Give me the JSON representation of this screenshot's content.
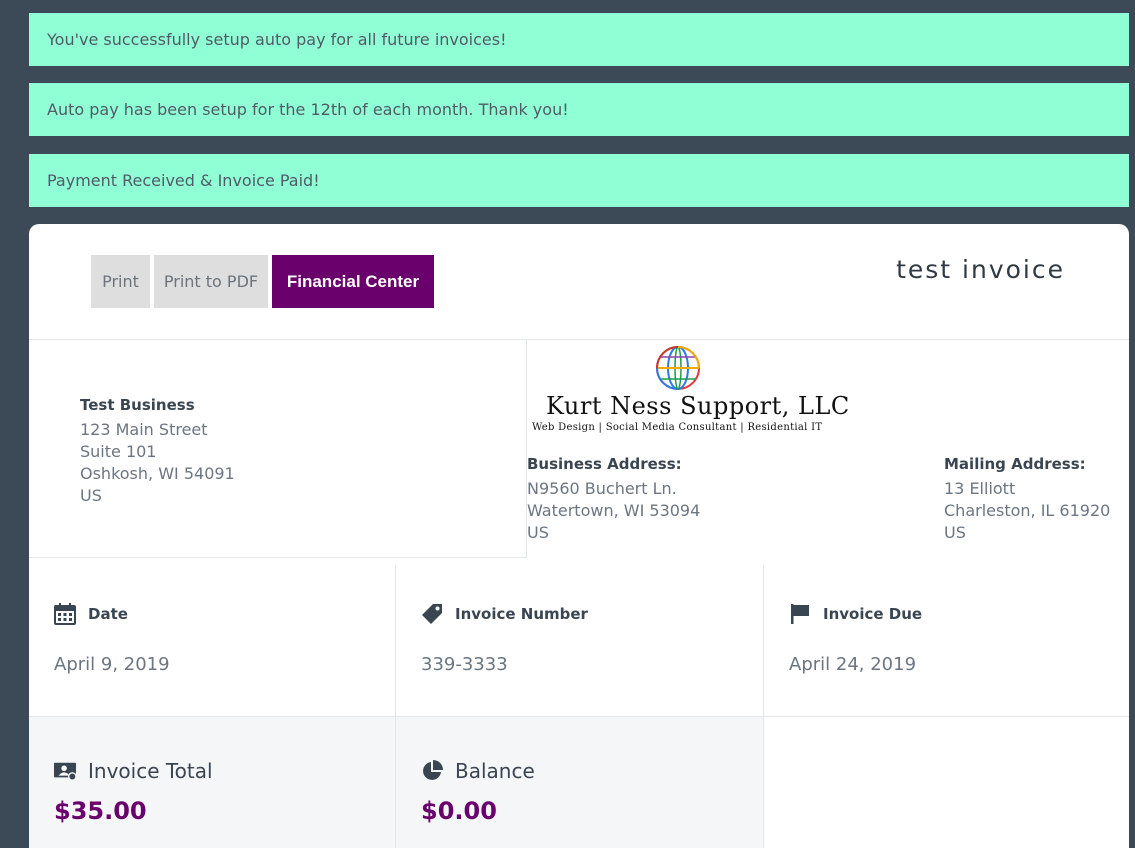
{
  "notices": [
    "You've successfully setup auto pay for all future invoices!",
    "Auto pay has been setup for the 12th of each month. Thank you!",
    "Payment Received & Invoice Paid!"
  ],
  "toolbar": {
    "print_label": "Print",
    "pdf_label": "Print to PDF",
    "financial_label": "Financial Center",
    "accent_color": "#69006b"
  },
  "invoice_title": "test invoice",
  "bill_to": {
    "name": "Test Business",
    "lines": [
      "123 Main Street",
      "Suite 101",
      "Oshkosh, WI 54091",
      "US"
    ]
  },
  "company": {
    "name": "Kurt Ness Support, LLC",
    "tagline": "Web Design | Social Media Consultant | Residential IT",
    "logo_icon": "globe-icon"
  },
  "business_address": {
    "heading": "Business Address:",
    "lines": [
      "N9560 Buchert Ln.",
      "Watertown, WI 53094",
      "US"
    ]
  },
  "mailing_address": {
    "heading": "Mailing Address:",
    "lines": [
      "13 Elliott",
      "Charleston, IL 61920",
      "US"
    ]
  },
  "meta": {
    "date": {
      "label": "Date",
      "value": "April 9, 2019",
      "icon": "calendar-icon"
    },
    "number": {
      "label": "Invoice Number",
      "value": "339-3333",
      "icon": "tag-icon"
    },
    "due": {
      "label": "Invoice Due",
      "value": "April 24, 2019",
      "icon": "flag-icon"
    }
  },
  "totals": {
    "total": {
      "label": "Invoice Total",
      "value": "$35.00",
      "icon": "invoice-money-icon"
    },
    "balance": {
      "label": "Balance",
      "value": "$0.00",
      "icon": "pie-chart-icon"
    }
  }
}
